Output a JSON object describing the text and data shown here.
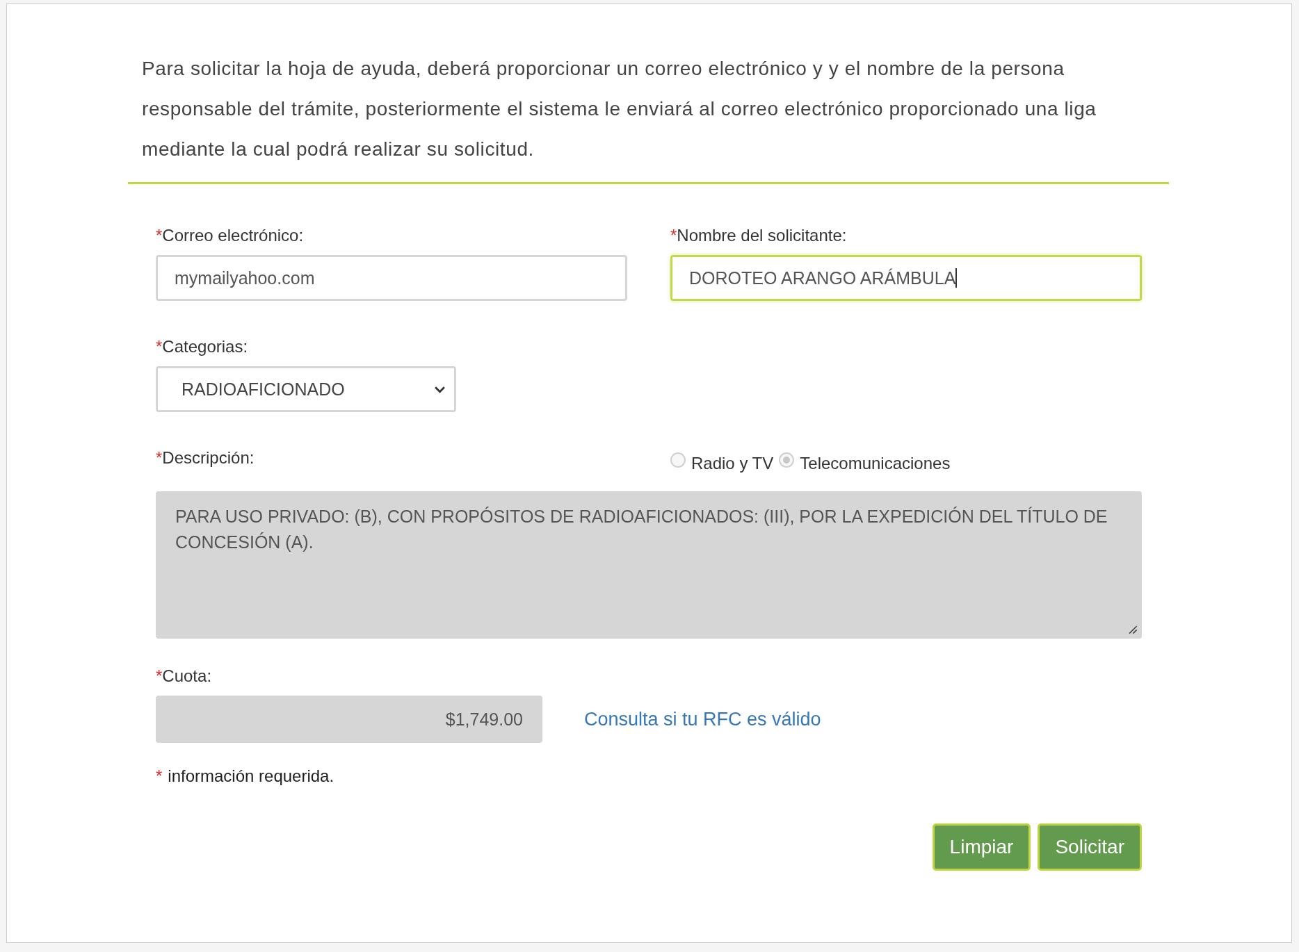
{
  "intro": "Para solicitar la hoja de ayuda, deberá proporcionar un correo electrónico y y el nombre de la persona responsable del trámite, posteriormente el sistema le enviará al correo electrónico proporcionado una liga mediante la cual podrá realizar su solicitud.",
  "email": {
    "required_mark": "*",
    "label": "Correo electrónico:",
    "value": "mymailyahoo.com",
    "focused": false
  },
  "name": {
    "required_mark": "*",
    "label": "Nombre del solicitante:",
    "value": "DOROTEO ARANGO ARÁMBULA",
    "focused": true
  },
  "category": {
    "required_mark": "*",
    "label": "Categorias:",
    "value": "RADIOAFICIONADO"
  },
  "description": {
    "required_mark": "*",
    "label": "Descripción:",
    "value": "PARA USO PRIVADO: (B), CON PROPÓSITOS DE RADIOAFICIONADOS: (III), POR LA EXPEDICIÓN DEL TÍTULO DE CONCESIÓN (A).",
    "disabled": true
  },
  "service_type": [
    {
      "label": "Radio y TV",
      "selected": false,
      "disabled": true
    },
    {
      "label": "Telecomunicaciones",
      "selected": true,
      "disabled": true
    }
  ],
  "fee": {
    "required_mark": "*",
    "label": "Cuota:",
    "value": "$1,749.00",
    "disabled": true
  },
  "rfc_link": "Consulta si tu RFC es válido",
  "required_note": {
    "mark": "*",
    "text": "información requerida."
  },
  "buttons": [
    "Limpiar",
    "Solicitar"
  ]
}
